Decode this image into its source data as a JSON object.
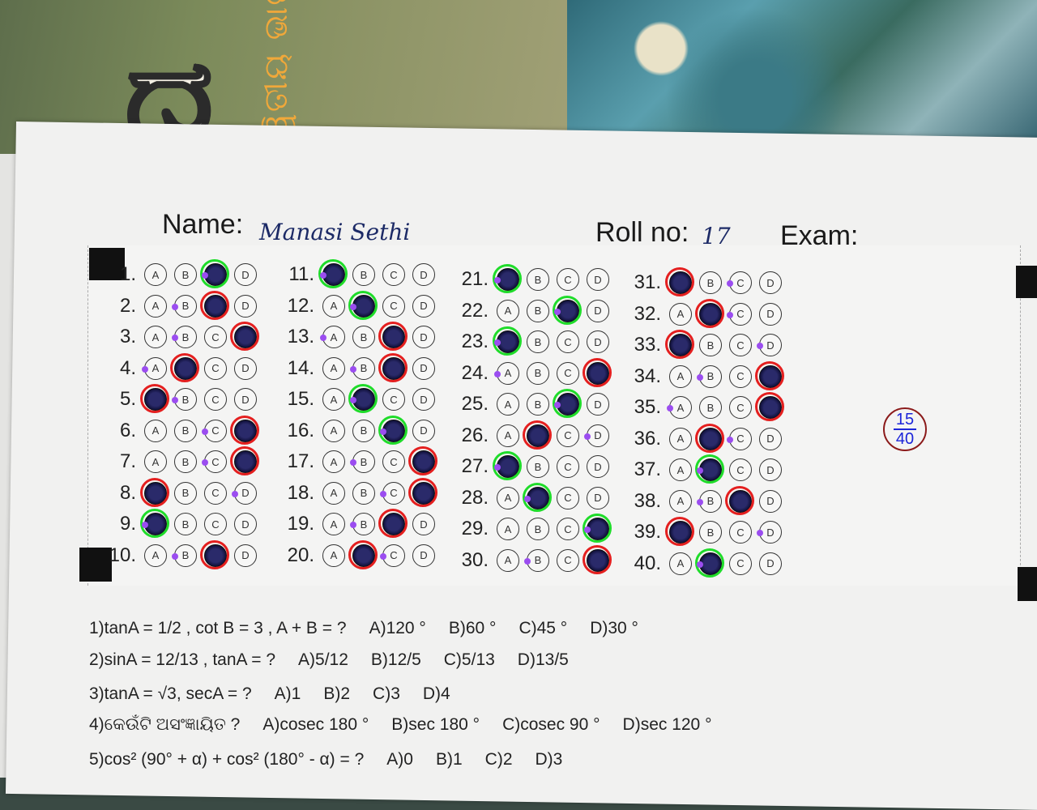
{
  "background": {
    "book_title": "ପ",
    "book_subtitle": "ଦ୍ୱିତୀୟ ଭାଗ)"
  },
  "sheet": {
    "name_label": "Name:",
    "name_value": "Manasi  Sethi",
    "roll_label": "Roll no:",
    "roll_value": "17",
    "exam_label": "Exam:",
    "score": {
      "numerator": "15",
      "denominator": "40"
    }
  },
  "options": [
    "A",
    "B",
    "C",
    "D"
  ],
  "omr": [
    {
      "q": "1.",
      "filled": "C",
      "mark": "green",
      "dot": "C"
    },
    {
      "q": "2.",
      "filled": "C",
      "mark": "red",
      "dot": "B"
    },
    {
      "q": "3.",
      "filled": "D",
      "mark": "red",
      "dot": "B"
    },
    {
      "q": "4.",
      "filled": "B",
      "mark": "red",
      "dot": "A"
    },
    {
      "q": "5.",
      "filled": "A",
      "mark": "red",
      "dot": "B"
    },
    {
      "q": "6.",
      "filled": "D",
      "mark": "red",
      "dot": "C"
    },
    {
      "q": "7.",
      "filled": "D",
      "mark": "red",
      "dot": "C"
    },
    {
      "q": "8.",
      "filled": "A",
      "mark": "red",
      "dot": "D"
    },
    {
      "q": "9.",
      "filled": "A",
      "mark": "green",
      "dot": "A"
    },
    {
      "q": "10.",
      "filled": "C",
      "mark": "red",
      "dot": "B"
    },
    {
      "q": "11.",
      "filled": "A",
      "mark": "green",
      "dot": "A"
    },
    {
      "q": "12.",
      "filled": "B",
      "mark": "green",
      "dot": "B"
    },
    {
      "q": "13.",
      "filled": "C",
      "mark": "red",
      "dot": "A"
    },
    {
      "q": "14.",
      "filled": "C",
      "mark": "red",
      "dot": "B"
    },
    {
      "q": "15.",
      "filled": "B",
      "mark": "green",
      "dot": "B"
    },
    {
      "q": "16.",
      "filled": "C",
      "mark": "green",
      "dot": "C"
    },
    {
      "q": "17.",
      "filled": "D",
      "mark": "red",
      "dot": "B"
    },
    {
      "q": "18.",
      "filled": "D",
      "mark": "red",
      "dot": "C"
    },
    {
      "q": "19.",
      "filled": "C",
      "mark": "red",
      "dot": "B"
    },
    {
      "q": "20.",
      "filled": "B",
      "mark": "red",
      "dot": "C"
    },
    {
      "q": "21.",
      "filled": "A",
      "mark": "green",
      "dot": "A"
    },
    {
      "q": "22.",
      "filled": "C",
      "mark": "green",
      "dot": "C"
    },
    {
      "q": "23.",
      "filled": "A",
      "mark": "green",
      "dot": "A"
    },
    {
      "q": "24.",
      "filled": "D",
      "mark": "red",
      "dot": "A"
    },
    {
      "q": "25.",
      "filled": "C",
      "mark": "green",
      "dot": "C"
    },
    {
      "q": "26.",
      "filled": "B",
      "mark": "red",
      "dot": "D"
    },
    {
      "q": "27.",
      "filled": "A",
      "mark": "green",
      "dot": "A"
    },
    {
      "q": "28.",
      "filled": "B",
      "mark": "green",
      "dot": "B"
    },
    {
      "q": "29.",
      "filled": "D",
      "mark": "green",
      "dot": "D"
    },
    {
      "q": "30.",
      "filled": "D",
      "mark": "red",
      "dot": "B"
    },
    {
      "q": "31.",
      "filled": "A",
      "mark": "red",
      "dot": "C"
    },
    {
      "q": "32.",
      "filled": "B",
      "mark": "red",
      "dot": "C"
    },
    {
      "q": "33.",
      "filled": "A",
      "mark": "red",
      "dot": "D"
    },
    {
      "q": "34.",
      "filled": "D",
      "mark": "red",
      "dot": "B"
    },
    {
      "q": "35.",
      "filled": "D",
      "mark": "red",
      "dot": "A"
    },
    {
      "q": "36.",
      "filled": "B",
      "mark": "red",
      "dot": "C"
    },
    {
      "q": "37.",
      "filled": "B",
      "mark": "green",
      "dot": "B"
    },
    {
      "q": "38.",
      "filled": "C",
      "mark": "red",
      "dot": "B"
    },
    {
      "q": "39.",
      "filled": "A",
      "mark": "red",
      "dot": "D"
    },
    {
      "q": "40.",
      "filled": "B",
      "mark": "green",
      "dot": "B"
    }
  ],
  "questions": [
    {
      "text": "1)tanA = 1/2 , cot B = 3 , A + B = ?",
      "opts": [
        "A)120 °",
        "B)60 °",
        "C)45 °",
        "D)30 °"
      ]
    },
    {
      "text": "2)sinA = 12/13 , tanA = ?",
      "opts": [
        "A)5/12",
        "B)12/5",
        "C)5/13",
        "D)13/5"
      ]
    },
    {
      "text": "3)tanA = √3, secA = ?",
      "opts": [
        "A)1",
        "B)2",
        "C)3",
        "D)4"
      ]
    },
    {
      "text": "4)କେଉଁଟି ଅସଂଜ୍ଞାୟିତ ?",
      "opts": [
        "A)cosec 180 °",
        "B)sec 180 °",
        "C)cosec 90 °",
        "D)sec 120 °"
      ]
    },
    {
      "text": "5)cos² (90° + α)  + cos² (180° - α)  = ?",
      "opts": [
        "A)0",
        "B)1",
        "C)2",
        "D)3"
      ]
    }
  ]
}
